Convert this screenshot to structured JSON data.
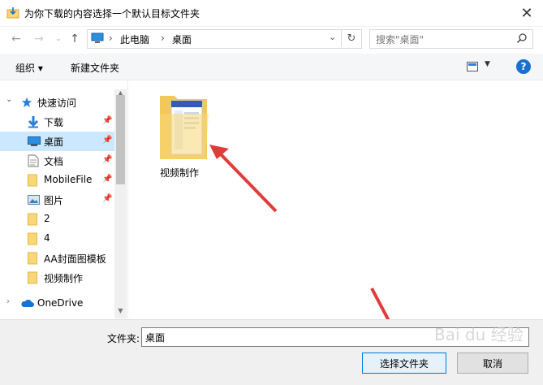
{
  "window": {
    "title": "为你下载的内容选择一个默认目标文件夹"
  },
  "breadcrumb": [
    "此电脑",
    "桌面"
  ],
  "search": {
    "placeholder": "搜索\"桌面\""
  },
  "toolbar": {
    "organize_label": "组织 ▾",
    "new_folder_label": "新建文件夹",
    "help_label": "?"
  },
  "sidebar": {
    "items": [
      {
        "label": "快速访问",
        "icon": "star-icon"
      },
      {
        "label": "下载",
        "icon": "download-icon",
        "pinned": true
      },
      {
        "label": "桌面",
        "icon": "desktop-icon",
        "pinned": true,
        "selected": true
      },
      {
        "label": "文档",
        "icon": "document-icon",
        "pinned": true
      },
      {
        "label": "MobileFile",
        "icon": "folder-icon",
        "pinned": true
      },
      {
        "label": "图片",
        "icon": "picture-icon",
        "pinned": true
      },
      {
        "label": "2",
        "icon": "folder-icon"
      },
      {
        "label": "4",
        "icon": "folder-icon"
      },
      {
        "label": "AA封面图模板",
        "icon": "folder-icon"
      },
      {
        "label": "视频制作",
        "icon": "folder-icon"
      },
      {
        "label": "OneDrive",
        "icon": "cloud-icon"
      }
    ]
  },
  "content": {
    "folders": [
      {
        "name": "视频制作"
      }
    ]
  },
  "bottom": {
    "folder_label": "文件夹:",
    "folder_value": "桌面",
    "select_button": "选择文件夹",
    "cancel_button": "取消"
  },
  "colors": {
    "accent": "#0078d7",
    "selected_bg": "#cce8ff",
    "arrow": "#e03c3c",
    "folder": "#f8d775"
  },
  "watermark": "Bai du 经验"
}
